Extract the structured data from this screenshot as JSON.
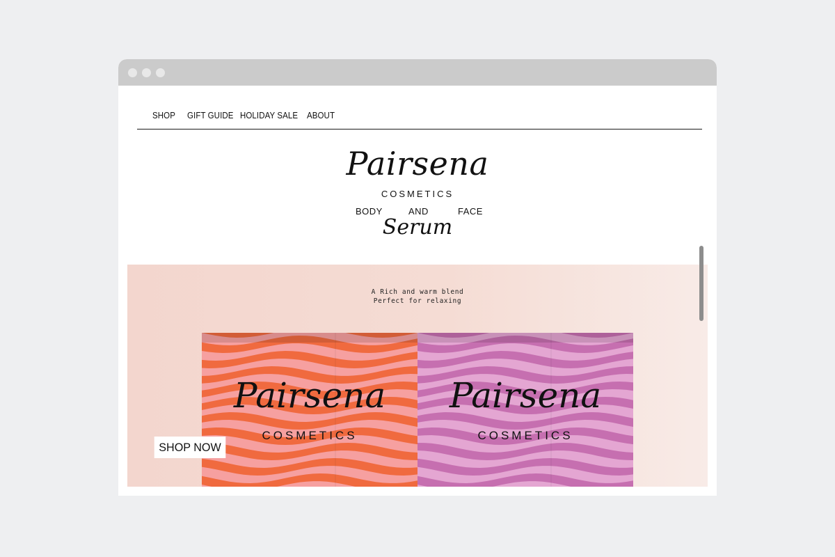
{
  "nav": {
    "items": [
      {
        "label": "SHOP"
      },
      {
        "label": "GIFT GUIDE"
      },
      {
        "label": "HOLIDAY SALE"
      },
      {
        "label": "ABOUT"
      }
    ]
  },
  "brand": {
    "name": "Pairsena",
    "subtitle": "COSMETICS",
    "line_left": "BODY",
    "line_mid": "AND",
    "line_right": "FACE",
    "product": "Serum"
  },
  "hero": {
    "tagline_1": "A Rich and warm blend",
    "tagline_2": "Perfect for relaxing",
    "boxes": [
      {
        "name": "Pairsena",
        "subtitle": "COSMETICS",
        "color": "#f06a3f",
        "stripe_color": "#f6a0a0"
      },
      {
        "name": "Pairsena",
        "subtitle": "COSMETICS",
        "color": "#c66fb0",
        "stripe_color": "#e4a6d2"
      }
    ],
    "cta_label": "SHOP NOW"
  },
  "colors": {
    "page_bg": "#eeeff1",
    "titlebar": "#cbcbcb",
    "hero_bg": "#f3d6ce"
  }
}
